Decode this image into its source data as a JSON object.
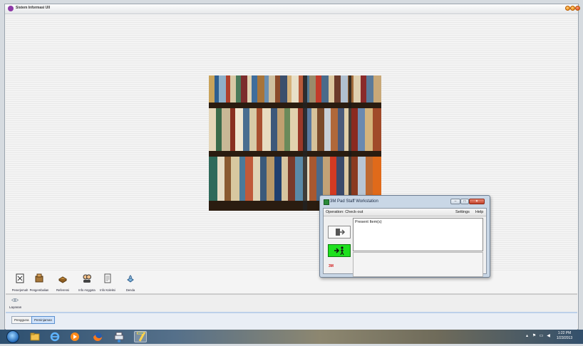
{
  "window": {
    "title": "Sistem Informasi UII"
  },
  "desktop_icons": [
    {
      "label": "Penerjemah",
      "icon": "document-text-icon"
    },
    {
      "label": "Pengembalian",
      "icon": "return-box-icon"
    },
    {
      "label": "Referensi",
      "icon": "reference-books-icon"
    },
    {
      "label": "Info Anggota",
      "icon": "members-icon"
    },
    {
      "label": "Info Koleksi",
      "icon": "collection-page-icon"
    },
    {
      "label": "Denda",
      "icon": "fine-icon"
    }
  ],
  "layanan": {
    "label": "Layanan",
    "icon": "eye-icon"
  },
  "tabs": [
    {
      "label": "Pengguna",
      "selected": false
    },
    {
      "label": "Peminjaman",
      "selected": true
    }
  ],
  "dialog": {
    "title": "3M Pad Staff Workstation",
    "operation": "Operation: Check-out",
    "menu": [
      "Settings",
      "Help"
    ],
    "present_items": "Present Item(s)",
    "brand": "3M",
    "checkin_color": "#1ee01e"
  },
  "taskbar": {
    "apps": [
      "windows-explorer-icon",
      "internet-explorer-icon",
      "media-player-icon",
      "firefox-icon",
      "network-printer-icon",
      "app-7-icon"
    ],
    "time": "1:22 PM",
    "date": "1/23/2013"
  }
}
